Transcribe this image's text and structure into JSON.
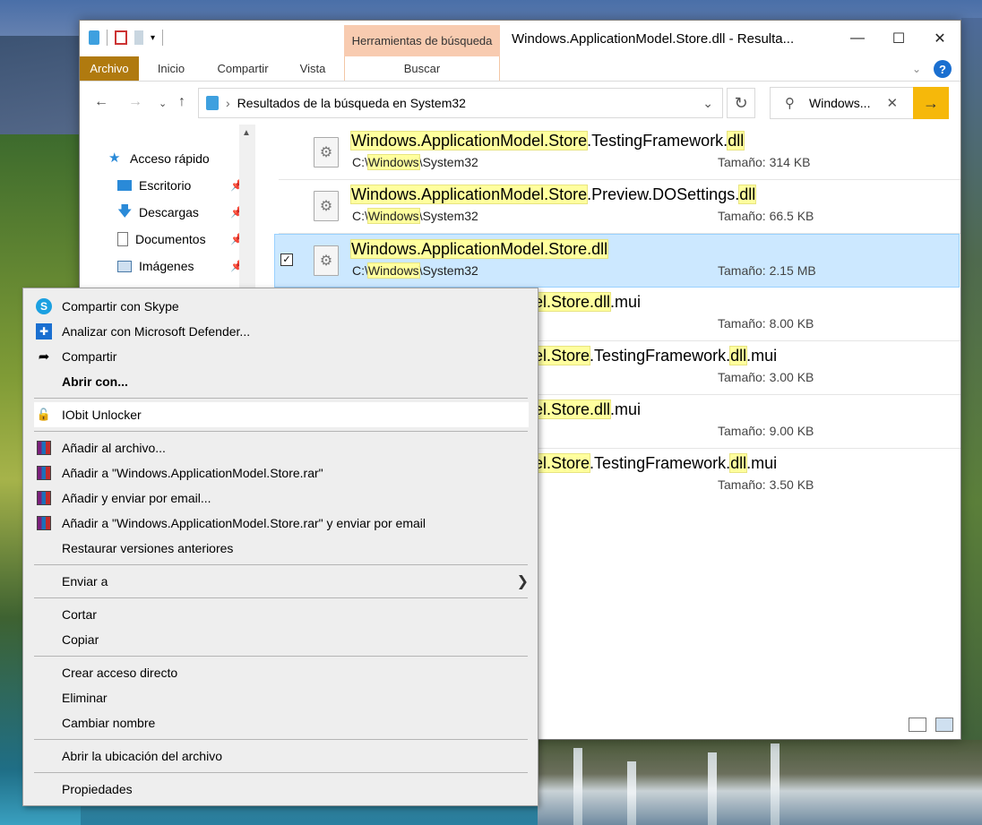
{
  "window": {
    "title": "Windows.ApplicationModel.Store.dll - Resulta...",
    "context_tab_header": "Herramientas de búsqueda"
  },
  "ribbon": {
    "tabs": [
      "Archivo",
      "Inicio",
      "Compartir",
      "Vista"
    ],
    "context_tab": "Buscar",
    "help": "?"
  },
  "address": {
    "path": "Resultados de la búsqueda en System32"
  },
  "search": {
    "value": "Windows..."
  },
  "sidebar": {
    "items": [
      {
        "label": "Acceso rápido",
        "icon": "star-icon"
      },
      {
        "label": "Escritorio",
        "icon": "desktop-icon"
      },
      {
        "label": "Descargas",
        "icon": "download-icon"
      },
      {
        "label": "Documentos",
        "icon": "document-icon"
      },
      {
        "label": "Imágenes",
        "icon": "image-icon"
      }
    ]
  },
  "results": [
    {
      "name_parts": [
        "Windows.ApplicationModel.Store",
        ".TestingFramework.",
        "dll",
        ""
      ],
      "path_parts": [
        "C:\\",
        "Windows",
        "\\System32"
      ],
      "size": "Tamaño: 314 KB"
    },
    {
      "name_parts": [
        "Windows.ApplicationModel.Store",
        ".Preview.DOSettings.",
        "dll",
        ""
      ],
      "path_parts": [
        "C:\\",
        "Windows",
        "\\System32"
      ],
      "size": "Tamaño: 66.5 KB"
    },
    {
      "name_parts": [
        "Windows.ApplicationModel.Store.dll",
        "",
        "",
        ""
      ],
      "path_parts": [
        "C:\\",
        "Windows",
        "\\System32"
      ],
      "size": "Tamaño: 2.15 MB",
      "selected": true
    },
    {
      "name_parts": [
        "el.Store.dll",
        ".mui",
        "",
        ""
      ],
      "size": "Tamaño: 8.00 KB"
    },
    {
      "name_parts": [
        "el.Store",
        ".TestingFramework.",
        "dll",
        ".mui"
      ],
      "size": "Tamaño: 3.00 KB"
    },
    {
      "name_parts": [
        "el.Store.dll",
        ".mui",
        "",
        ""
      ],
      "size": "Tamaño: 9.00 KB"
    },
    {
      "name_parts": [
        "el.Store",
        ".TestingFramework.",
        "dll",
        ".mui"
      ],
      "size": "Tamaño: 3.50 KB"
    }
  ],
  "context_menu": {
    "items": [
      {
        "label": "Compartir con Skype",
        "icon": "skype-icon"
      },
      {
        "label": "Analizar con Microsoft Defender...",
        "icon": "defender-icon"
      },
      {
        "label": "Compartir",
        "icon": "share-icon"
      },
      {
        "label": "Abrir con...",
        "bold": true
      },
      {
        "label": "IObit Unlocker",
        "icon": "unlock-icon"
      },
      {
        "label": "Añadir al archivo...",
        "icon": "winrar-icon"
      },
      {
        "label": "Añadir a \"Windows.ApplicationModel.Store.rar\"",
        "icon": "winrar-icon"
      },
      {
        "label": "Añadir y enviar por email...",
        "icon": "winrar-icon"
      },
      {
        "label": "Añadir a \"Windows.ApplicationModel.Store.rar\" y enviar por email",
        "icon": "winrar-icon"
      },
      {
        "label": "Restaurar versiones anteriores"
      },
      {
        "label": "Enviar a",
        "submenu": true
      },
      {
        "label": "Cortar"
      },
      {
        "label": "Copiar"
      },
      {
        "label": "Crear acceso directo"
      },
      {
        "label": "Eliminar"
      },
      {
        "label": "Cambiar nombre"
      },
      {
        "label": "Abrir la ubicación del archivo"
      },
      {
        "label": "Propiedades"
      }
    ]
  }
}
